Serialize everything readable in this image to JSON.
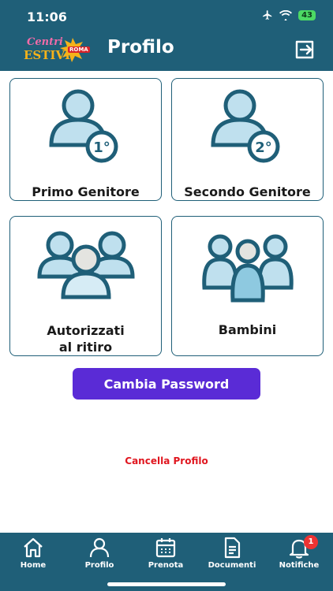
{
  "status_bar": {
    "time": "11:06",
    "battery": "43"
  },
  "header": {
    "logo_line1": "Centri",
    "logo_line2": "ESTIVI",
    "logo_badge": "ROMA",
    "title": "Profilo"
  },
  "cards": [
    {
      "label": "Primo Genitore",
      "badge": "1°"
    },
    {
      "label": "Secondo Genitore",
      "badge": "2°"
    },
    {
      "label_line1": "Autorizzati",
      "label_line2": "al ritiro"
    },
    {
      "label": "Bambini"
    }
  ],
  "actions": {
    "change_password": "Cambia Password",
    "delete_profile": "Cancella Profilo"
  },
  "tabs": [
    {
      "label": "Home",
      "icon": "home-icon"
    },
    {
      "label": "Profilo",
      "icon": "user-icon"
    },
    {
      "label": "Prenota",
      "icon": "calendar-icon"
    },
    {
      "label": "Documenti",
      "icon": "document-icon"
    },
    {
      "label": "Notifiche",
      "icon": "bell-icon",
      "badge": "1"
    }
  ],
  "colors": {
    "header": "#1f5f78",
    "card_border": "#1f5f78",
    "primary_button": "#5a2bd6",
    "danger_text": "#e0161f",
    "illustration_fill": "#bfe0ee",
    "illustration_stroke": "#1f5f78"
  }
}
